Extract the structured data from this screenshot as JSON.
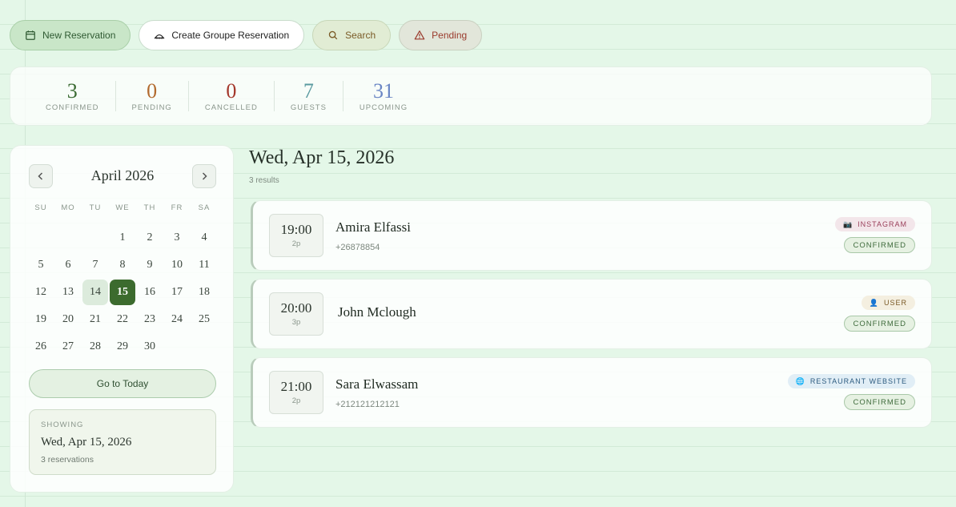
{
  "toolbar": {
    "new_reservation": "New Reservation",
    "create_group": "Create Groupe Reservation",
    "search": "Search",
    "pending": "Pending"
  },
  "stats": [
    {
      "value": "3",
      "label": "CONFIRMED",
      "color": "#3b6b33"
    },
    {
      "value": "0",
      "label": "PENDING",
      "color": "#b26a2e"
    },
    {
      "value": "0",
      "label": "CANCELLED",
      "color": "#a4382c"
    },
    {
      "value": "7",
      "label": "GUESTS",
      "color": "#5a9aa0"
    },
    {
      "value": "31",
      "label": "UPCOMING",
      "color": "#6a86c4"
    }
  ],
  "calendar": {
    "month_label": "April 2026",
    "weekdays": [
      "SU",
      "MO",
      "TU",
      "WE",
      "TH",
      "FR",
      "SA"
    ],
    "leading_blanks": 3,
    "days_in_month": 30,
    "today": 14,
    "selected": 15,
    "goto_today": "Go to Today",
    "showing_label": "SHOWING",
    "showing_date": "Wed, Apr 15, 2026",
    "showing_count": "3 reservations"
  },
  "main": {
    "title": "Wed, Apr 15, 2026",
    "results": "3 results"
  },
  "reservations": [
    {
      "time": "19:00",
      "party": "2p",
      "name": "Amira Elfassi",
      "phone": "+26878854",
      "source": "INSTAGRAM",
      "source_icon": "camera-icon",
      "status": "CONFIRMED"
    },
    {
      "time": "20:00",
      "party": "3p",
      "name": "John Mclough",
      "phone": "",
      "source": "USER",
      "source_icon": "user-icon",
      "status": "CONFIRMED"
    },
    {
      "time": "21:00",
      "party": "2p",
      "name": "Sara Elwassam",
      "phone": "+212121212121",
      "source": "RESTAURANT WEBSITE",
      "source_icon": "globe-icon",
      "status": "CONFIRMED"
    }
  ]
}
